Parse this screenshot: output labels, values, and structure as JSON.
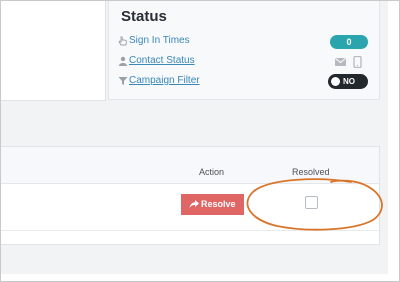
{
  "status": {
    "title": "Status",
    "rows": [
      {
        "label": "Sign In Times",
        "icon": "pointer-hand-icon",
        "badge": "0"
      },
      {
        "label": "Contact Status",
        "icon": "user-icon",
        "indicators": [
          "envelope-icon",
          "mobile-phone-icon"
        ]
      },
      {
        "label": "Campaign Filter",
        "icon": "filter-icon",
        "toggle": "NO"
      }
    ]
  },
  "table": {
    "headers": {
      "action": "Action",
      "resolved": "Resolved"
    },
    "rows": [
      {
        "action_label": "Resolve",
        "action_icon": "share-arrow-icon",
        "resolved": false
      }
    ]
  },
  "colors": {
    "badge": "#2aa5ad",
    "link": "#3a87b8",
    "resolve_button": "#e06666",
    "toggle": "#23282d",
    "annotation_ring": "#d9752a"
  }
}
